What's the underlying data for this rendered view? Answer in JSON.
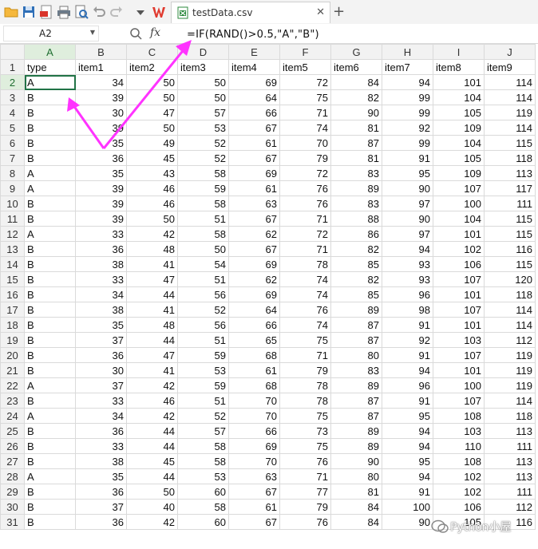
{
  "toolbar": {
    "icons": [
      "open-folder-icon",
      "save-icon",
      "export-pdf-icon",
      "print-icon",
      "print-preview-icon",
      "undo-icon",
      "redo-icon",
      "dropdown-icon",
      "wps-logo"
    ],
    "tab": {
      "label": "testData.csv",
      "close": "✕"
    },
    "new_tab": "+"
  },
  "formula_bar": {
    "name_box": "A2",
    "fx": "fx",
    "formula": "=IF(RAND()>0.5,\"A\",\"B\")"
  },
  "sheet": {
    "columns": [
      "A",
      "B",
      "C",
      "D",
      "E",
      "F",
      "G",
      "H",
      "I",
      "J"
    ],
    "active_column": "A",
    "active_row": 2,
    "header_row": [
      "type",
      "item1",
      "item2",
      "item3",
      "item4",
      "item5",
      "item6",
      "item7",
      "item8",
      "item9"
    ],
    "rows": [
      [
        "A",
        34,
        50,
        50,
        69,
        72,
        84,
        94,
        101,
        114
      ],
      [
        "B",
        39,
        50,
        50,
        64,
        75,
        82,
        99,
        104,
        114
      ],
      [
        "B",
        30,
        47,
        57,
        66,
        71,
        90,
        99,
        105,
        119
      ],
      [
        "B",
        39,
        50,
        53,
        67,
        74,
        81,
        92,
        109,
        114
      ],
      [
        "B",
        35,
        49,
        52,
        61,
        70,
        87,
        99,
        104,
        115
      ],
      [
        "B",
        36,
        45,
        52,
        67,
        79,
        81,
        91,
        105,
        118
      ],
      [
        "A",
        35,
        43,
        58,
        69,
        72,
        83,
        95,
        109,
        113
      ],
      [
        "A",
        39,
        46,
        59,
        61,
        76,
        89,
        90,
        107,
        117
      ],
      [
        "B",
        39,
        46,
        58,
        63,
        76,
        83,
        97,
        100,
        111
      ],
      [
        "B",
        39,
        50,
        51,
        67,
        71,
        88,
        90,
        104,
        115
      ],
      [
        "A",
        33,
        42,
        58,
        62,
        72,
        86,
        97,
        101,
        115
      ],
      [
        "B",
        36,
        48,
        50,
        67,
        71,
        82,
        94,
        102,
        116
      ],
      [
        "B",
        38,
        41,
        54,
        69,
        78,
        85,
        93,
        106,
        115
      ],
      [
        "B",
        33,
        47,
        51,
        62,
        74,
        82,
        93,
        107,
        120
      ],
      [
        "B",
        34,
        44,
        56,
        69,
        74,
        85,
        96,
        101,
        118
      ],
      [
        "B",
        38,
        41,
        52,
        64,
        76,
        89,
        98,
        107,
        114
      ],
      [
        "B",
        35,
        48,
        56,
        66,
        74,
        87,
        91,
        101,
        114
      ],
      [
        "B",
        37,
        44,
        51,
        65,
        75,
        87,
        92,
        103,
        112
      ],
      [
        "B",
        36,
        47,
        59,
        68,
        71,
        80,
        91,
        107,
        119
      ],
      [
        "B",
        30,
        41,
        53,
        61,
        79,
        83,
        94,
        101,
        119
      ],
      [
        "A",
        37,
        42,
        59,
        68,
        78,
        89,
        96,
        100,
        119
      ],
      [
        "B",
        33,
        46,
        51,
        70,
        78,
        87,
        91,
        107,
        114
      ],
      [
        "A",
        34,
        42,
        52,
        70,
        75,
        87,
        95,
        108,
        118
      ],
      [
        "B",
        36,
        44,
        57,
        66,
        73,
        89,
        94,
        103,
        113
      ],
      [
        "B",
        33,
        44,
        58,
        69,
        75,
        89,
        94,
        110,
        111
      ],
      [
        "B",
        38,
        45,
        58,
        70,
        76,
        90,
        95,
        108,
        113
      ],
      [
        "A",
        35,
        44,
        53,
        63,
        71,
        80,
        94,
        102,
        113
      ],
      [
        "B",
        36,
        50,
        60,
        67,
        77,
        81,
        91,
        102,
        111
      ],
      [
        "B",
        37,
        40,
        58,
        61,
        79,
        84,
        100,
        106,
        112
      ],
      [
        "B",
        36,
        42,
        60,
        67,
        76,
        84,
        90,
        105,
        116
      ]
    ]
  },
  "watermark": {
    "text": "Python小屋"
  },
  "colors": {
    "accent": "#217346",
    "annotation": "#ff33ff",
    "header_bg": "#f2f2f2"
  }
}
